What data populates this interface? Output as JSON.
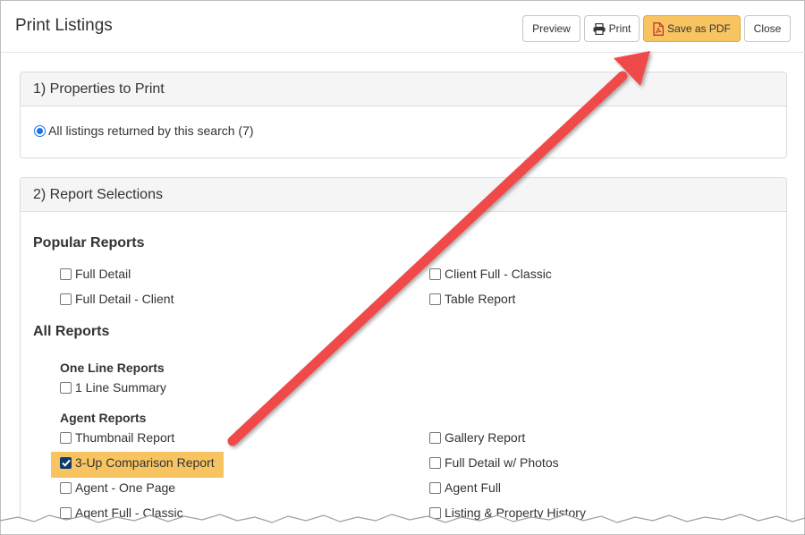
{
  "dialog": {
    "title": "Print Listings",
    "buttons": {
      "preview": "Preview",
      "print": "Print",
      "save_pdf": "Save as PDF",
      "close": "Close"
    }
  },
  "section1": {
    "heading": "1) Properties to Print",
    "radio_label": "All listings returned by this search (7)"
  },
  "section2": {
    "heading": "2) Report Selections",
    "popular_heading": "Popular Reports",
    "popular": {
      "full_detail": "Full Detail",
      "client_full_classic": "Client Full - Classic",
      "full_detail_client": "Full Detail - Client",
      "table_report": "Table Report"
    },
    "all_heading": "All Reports",
    "one_line_heading": "One Line Reports",
    "one_line": {
      "line_summary": "1 Line Summary"
    },
    "agent_heading": "Agent Reports",
    "agent": {
      "thumbnail": "Thumbnail Report",
      "gallery": "Gallery Report",
      "three_up": "3-Up Comparison Report",
      "full_detail_photos": "Full Detail w/ Photos",
      "agent_one_page": "Agent - One Page",
      "agent_full": "Agent Full",
      "agent_full_classic": "Agent Full - Classic",
      "listing_property_history": "Listing & Property History"
    }
  },
  "colors": {
    "highlight": "#f8c461",
    "arrow": "#f04a4a",
    "checkbox_checked": "#0b3a6b",
    "radio": "#1a73e8"
  },
  "icons": {
    "print": "printer-icon",
    "pdf": "pdf-file-icon"
  }
}
